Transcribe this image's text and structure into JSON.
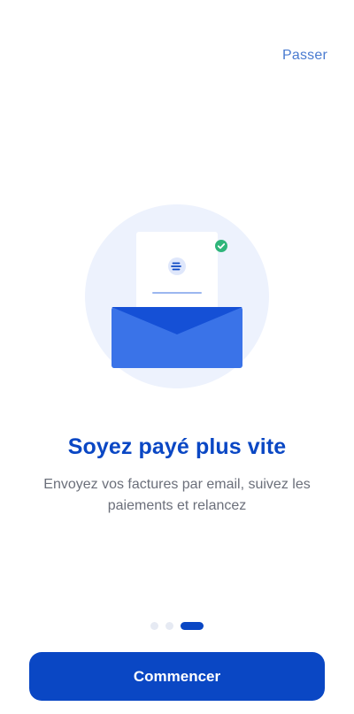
{
  "header": {
    "skip_label": "Passer"
  },
  "illustration": {
    "name": "invoice-email-envelope",
    "colors": {
      "circle_bg": "#edf2fd",
      "envelope": "#3a73e8",
      "envelope_flap": "#1550d6",
      "check_badge": "#2fb57a"
    }
  },
  "content": {
    "title": "Soyez payé plus vite",
    "subtitle": "Envoyez vos factures par email, suivez les paiements et relancez"
  },
  "pager": {
    "pages": 3,
    "current": 3
  },
  "footer": {
    "cta_label": "Commencer"
  },
  "colors": {
    "accent": "#0a47c4",
    "link": "#4a7bd0",
    "muted_text": "#6b6f7a"
  }
}
